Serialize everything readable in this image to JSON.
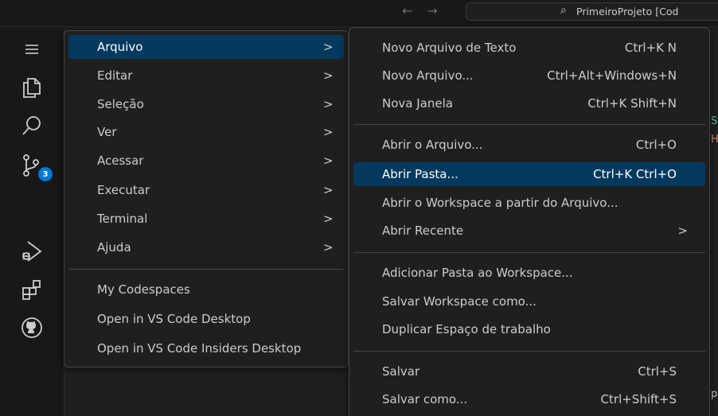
{
  "titlebar": {
    "search_text": "PrimeiroProjeto [Cod"
  },
  "activity_bar": {
    "icons": [
      "menu-icon",
      "explorer-icon",
      "search-icon",
      "source-control-icon",
      "run-debug-icon",
      "extensions-icon",
      "github-icon"
    ],
    "source_control_badge": "3",
    "badge_color": "#0078d4"
  },
  "main_menu": {
    "items": [
      {
        "label": "Arquivo",
        "arrow": ">"
      },
      {
        "label": "Editar",
        "arrow": ">"
      },
      {
        "label": "Seleção",
        "arrow": ">"
      },
      {
        "label": "Ver",
        "arrow": ">"
      },
      {
        "label": "Acessar",
        "arrow": ">"
      },
      {
        "label": "Executar",
        "arrow": ">"
      },
      {
        "label": "Terminal",
        "arrow": ">"
      },
      {
        "label": "Ajuda",
        "arrow": ">"
      }
    ],
    "extra_items": [
      {
        "label": "My Codespaces"
      },
      {
        "label": "Open in VS Code Desktop"
      },
      {
        "label": "Open in VS Code Insiders Desktop"
      }
    ]
  },
  "file_menu": {
    "items": [
      {
        "label": "Novo Arquivo de Texto",
        "key": "Ctrl+K N"
      },
      {
        "label": "Novo Arquivo...",
        "key": "Ctrl+Alt+Windows+N"
      },
      {
        "label": "Nova Janela",
        "key": "Ctrl+K Shift+N"
      },
      {
        "label": "Abrir o Arquivo...",
        "key": "Ctrl+O"
      },
      {
        "label": "Abrir Pasta...",
        "key": "Ctrl+K Ctrl+O"
      },
      {
        "label": "Abrir o Workspace a partir do Arquivo...",
        "key": ""
      },
      {
        "label": "Abrir Recente",
        "key": ">"
      },
      {
        "label": "Adicionar Pasta ao Workspace...",
        "key": ""
      },
      {
        "label": "Salvar Workspace como...",
        "key": ""
      },
      {
        "label": "Duplicar Espaço de trabalho",
        "key": ""
      },
      {
        "label": "Salvar",
        "key": "Ctrl+S"
      },
      {
        "label": "Salvar como...",
        "key": "Ctrl+Shift+S"
      }
    ]
  },
  "peek_text": {
    "line1": "S",
    "line2": "H",
    "line3": "p"
  },
  "colors": {
    "highlight": "#04395e",
    "background": "#1f1f1f"
  }
}
